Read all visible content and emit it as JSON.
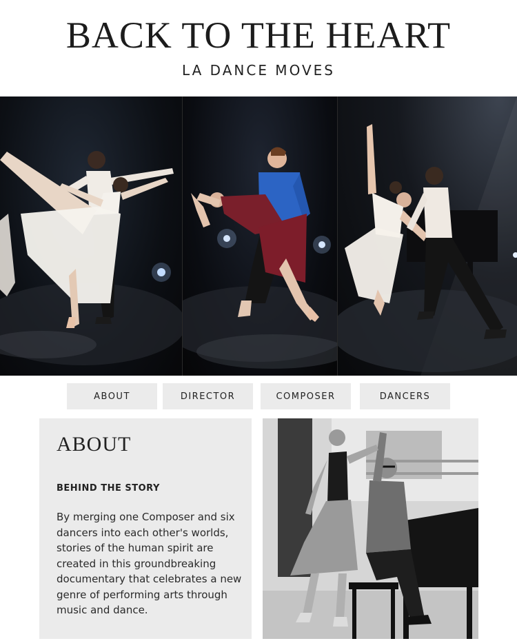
{
  "header": {
    "title": "BACK TO THE HEART",
    "subtitle": "LA DANCE MOVES"
  },
  "nav": {
    "items": [
      {
        "label": "ABOUT"
      },
      {
        "label": "DIRECTOR"
      },
      {
        "label": "COMPOSER"
      },
      {
        "label": "DANCERS"
      }
    ]
  },
  "about": {
    "heading": "ABOUT",
    "subheading": "BEHIND THE STORY",
    "body": "By merging one Composer and six dancers into each other's worlds, stories of the human spirit are created in this groundbreaking documentary that celebrates a new genre of performing arts through music and dance."
  },
  "colors": {
    "nav_bg": "#ebebeb",
    "about_bg": "#ebebeb",
    "text": "#222222"
  }
}
